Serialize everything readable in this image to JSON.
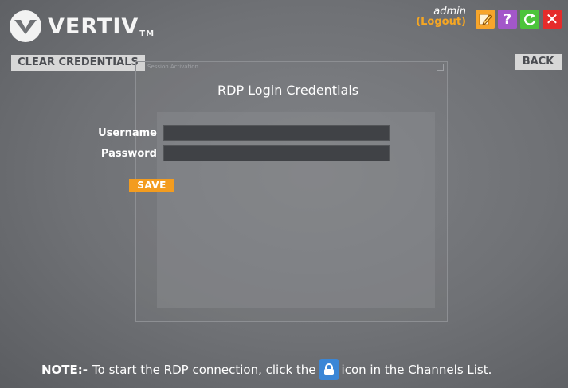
{
  "header": {
    "brand": "VERTIV",
    "brand_tm": "TM",
    "user": "admin",
    "logout": "(Logout)",
    "icons": [
      "edit-icon",
      "help-icon",
      "refresh-icon",
      "close-icon"
    ],
    "help_glyph": "?",
    "close_glyph": "✕"
  },
  "toolbar": {
    "clear_label": "CLEAR CREDENTIALS",
    "back_label": "BACK"
  },
  "dialog": {
    "window_title": "Session Activation",
    "title": "RDP Login Credentials",
    "username_label": "Username",
    "password_label": "Password",
    "username_value": "",
    "password_value": "",
    "save_label": "SAVE"
  },
  "note": {
    "prefix": "NOTE:-",
    "text_before": "To start the RDP connection, click the",
    "icon": "lock-icon",
    "text_after": "icon in the Channels List."
  },
  "colors": {
    "accent_orange": "#f39c1f",
    "help_purple": "#a357c9",
    "refresh_green": "#4cc43a",
    "close_red": "#e52b2b",
    "lock_blue": "#3a86d6"
  }
}
